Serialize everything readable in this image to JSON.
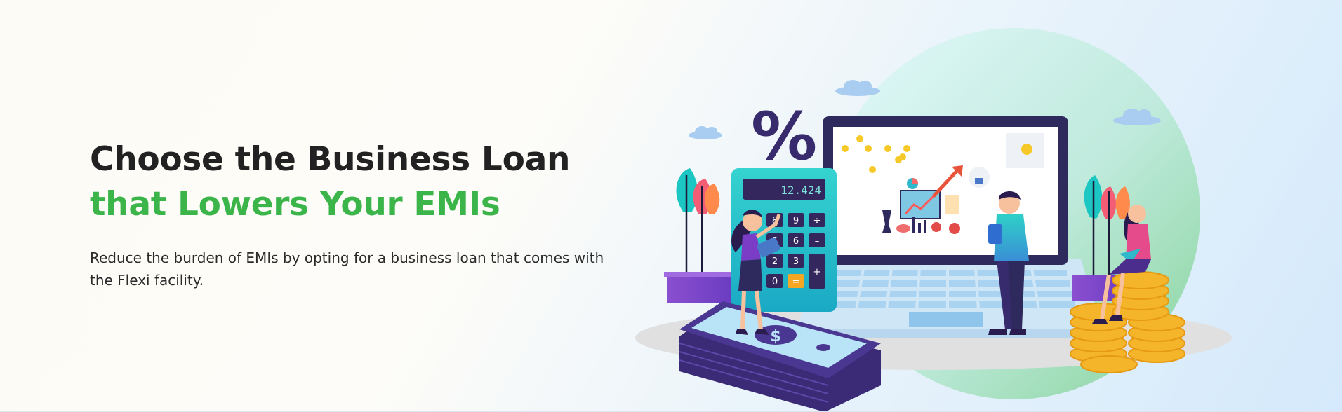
{
  "hero": {
    "title_main": "Choose the Business Loan ",
    "title_accent": "that Lowers Your EMIs",
    "subtitle": "Reduce the burden of EMIs by opting for a business loan that comes with the Flexi facility."
  },
  "illustration": {
    "percent_symbol": "%",
    "calculator_display": "12.424",
    "calculator_keys": [
      "8",
      "9",
      "÷",
      "5",
      "6",
      "–",
      "2",
      "3",
      "+",
      "·",
      "0",
      "="
    ],
    "money_symbol": "$"
  },
  "colors": {
    "accent_green": "#3bb54a",
    "heading_dark": "#222222",
    "navy": "#2f2a5e",
    "teal": "#1fc3c8",
    "coin_gold": "#f5b52a"
  }
}
